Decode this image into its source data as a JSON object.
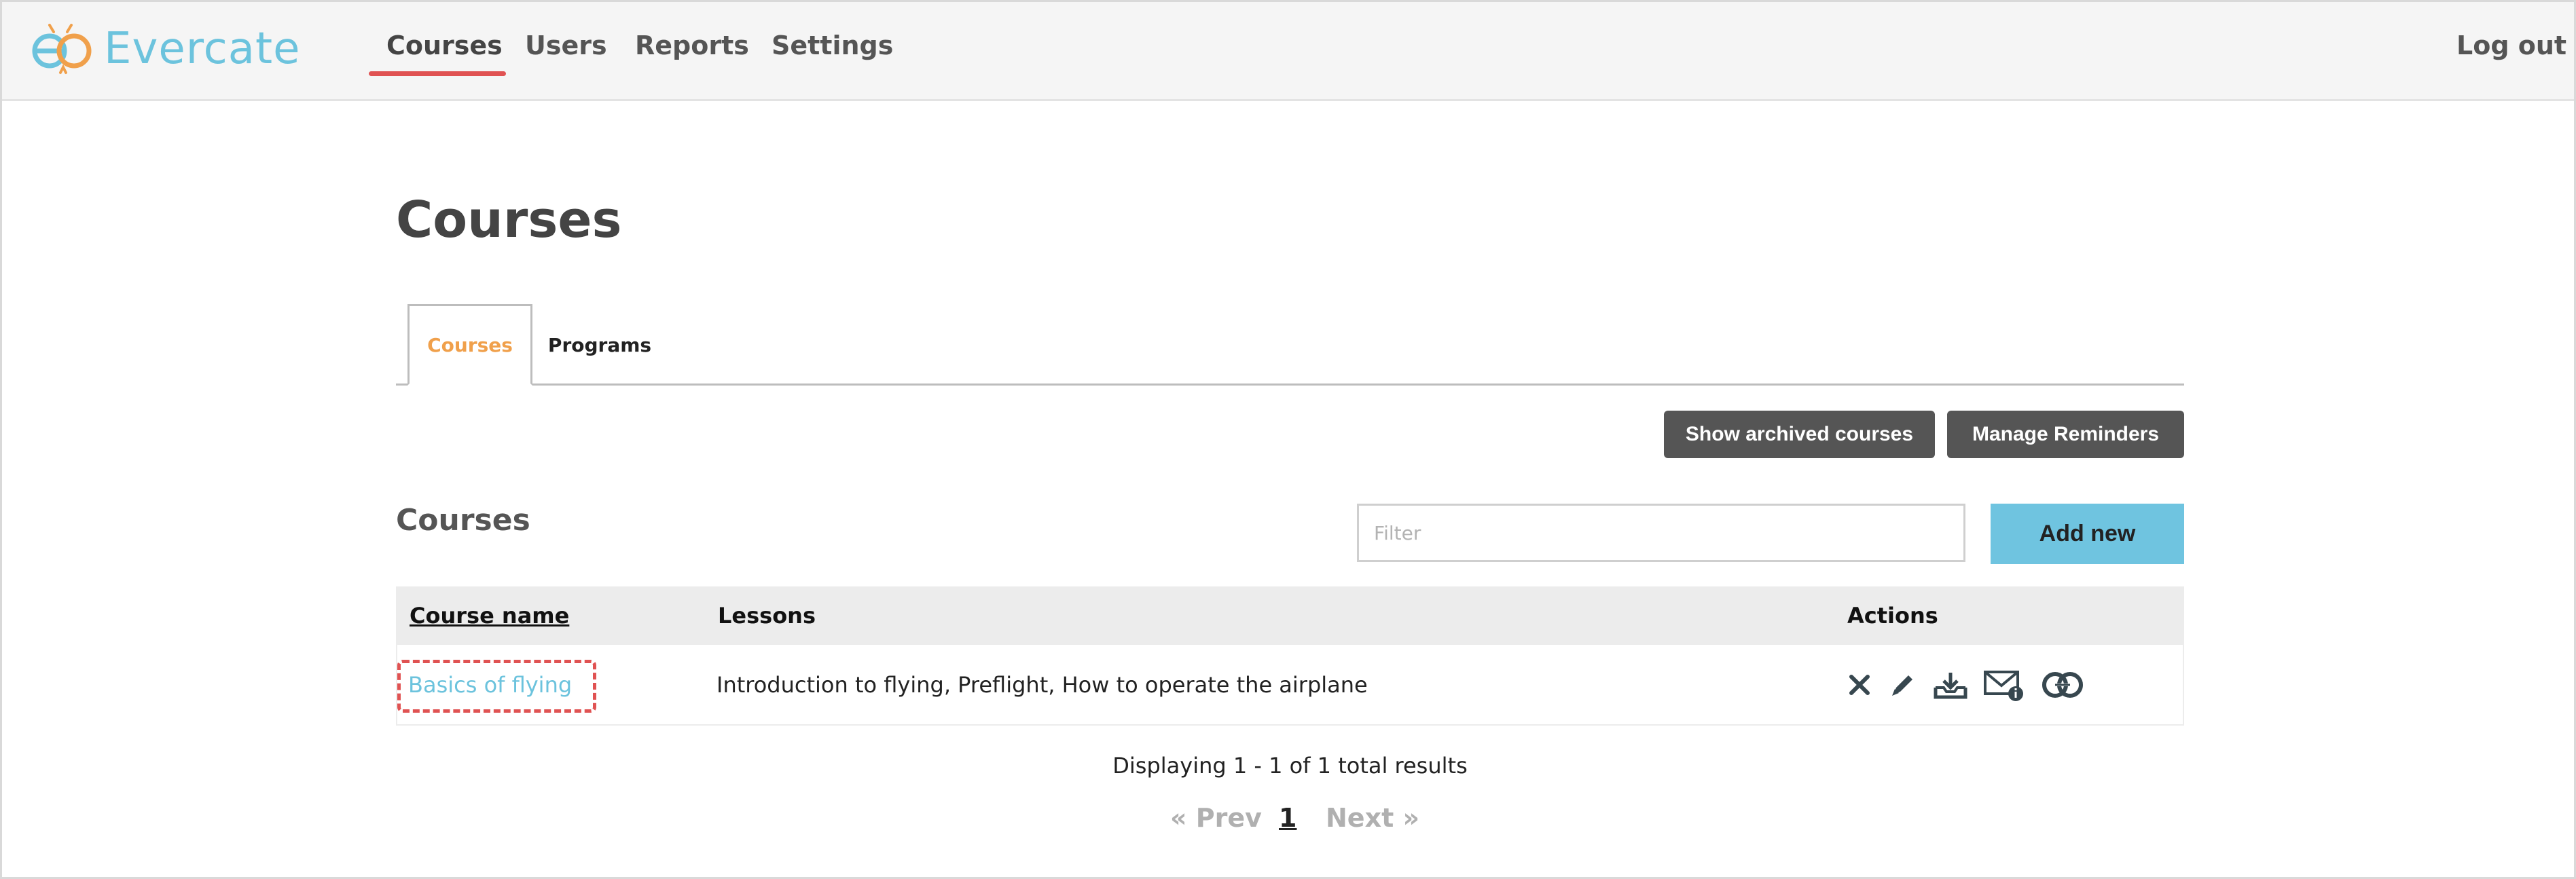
{
  "brand": {
    "name": "Evercate",
    "logo_color": "#6cc3dd",
    "logo_accent": "#f0a04b"
  },
  "nav": {
    "items": [
      {
        "label": "Courses",
        "active": true
      },
      {
        "label": "Users",
        "active": false
      },
      {
        "label": "Reports",
        "active": false
      },
      {
        "label": "Settings",
        "active": false
      }
    ],
    "logout_label": "Log out",
    "active_color": "#e05252"
  },
  "page": {
    "title": "Courses"
  },
  "tabs": [
    {
      "label": "Courses",
      "active": true
    },
    {
      "label": "Programs",
      "active": false
    }
  ],
  "toolbar": {
    "show_archived_label": "Show archived courses",
    "manage_reminders_label": "Manage Reminders"
  },
  "courses_section": {
    "title": "Courses",
    "filter_placeholder": "Filter",
    "filter_value": "",
    "add_new_label": "Add new"
  },
  "table": {
    "columns": [
      "Course name",
      "Lessons",
      "Actions"
    ],
    "rows": [
      {
        "course_name": "Basics of flying",
        "lessons": "Introduction to flying, Preflight, How to operate the airplane",
        "actions": [
          "close-icon",
          "pencil-icon",
          "download-tray-icon",
          "mail-info-icon",
          "link-icon"
        ]
      }
    ]
  },
  "pagination": {
    "summary": "Displaying 1 - 1 of 1 total results",
    "prev_label": "« Prev",
    "current_page": "1",
    "next_label": "Next »"
  }
}
